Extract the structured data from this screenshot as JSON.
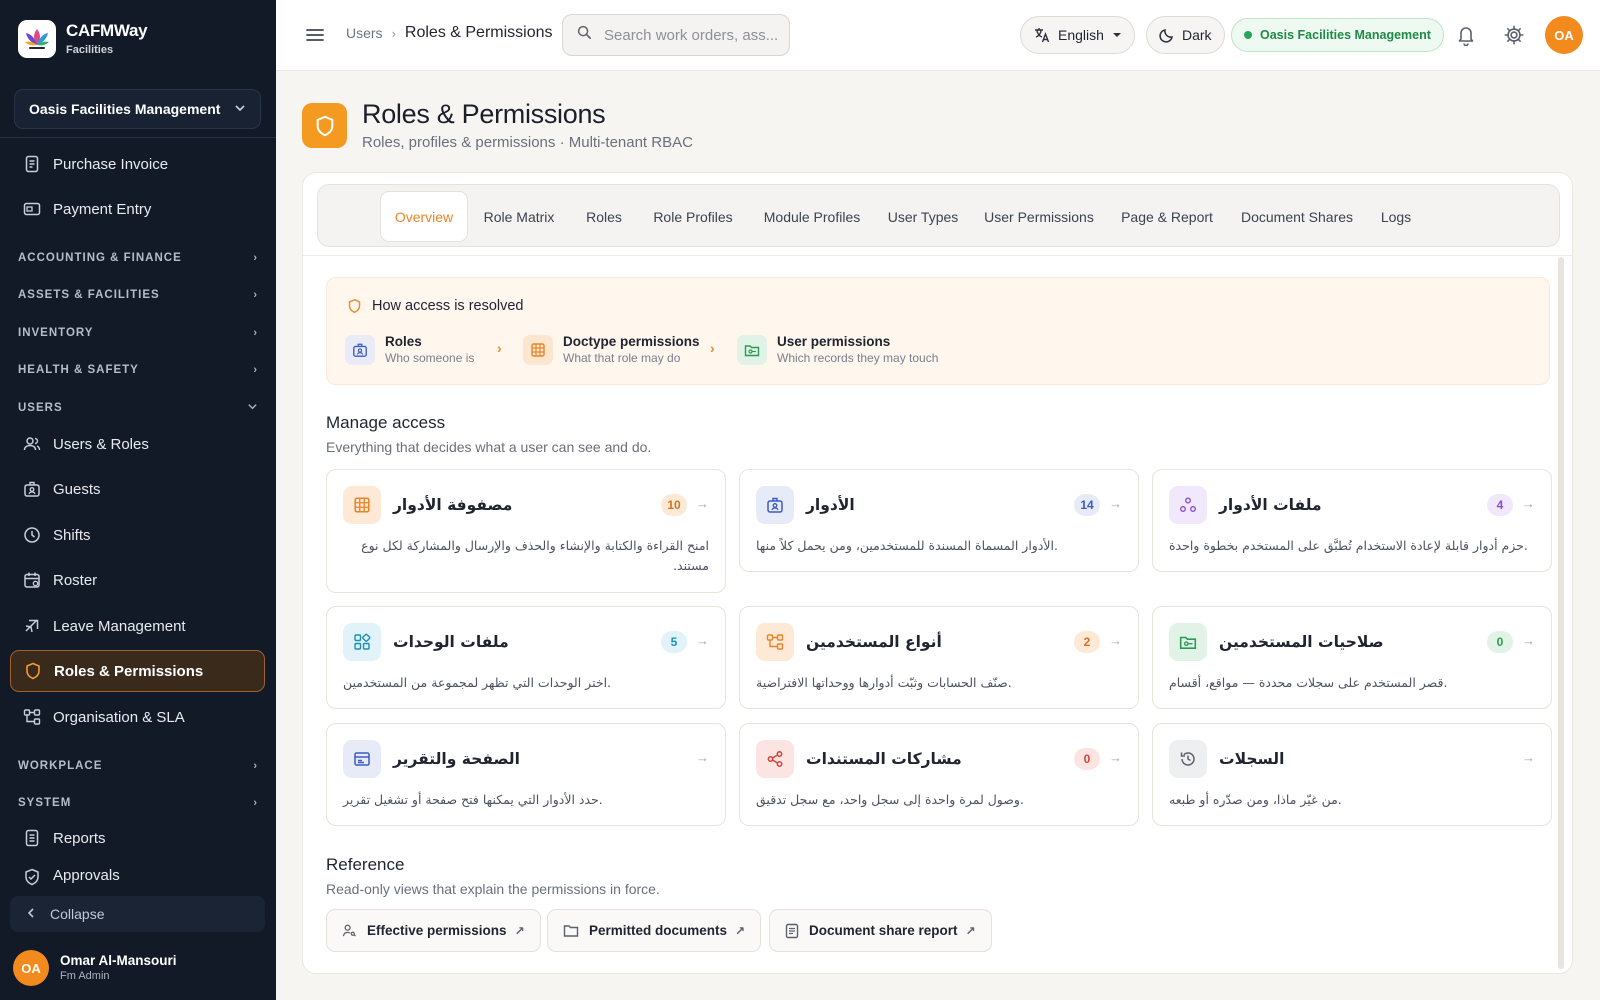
{
  "brand": {
    "name": "CAFMWay",
    "sub": "Facilities"
  },
  "sidebar": {
    "tenant": "Oasis Facilities Management",
    "items": [
      {
        "label": "Purchase Invoice"
      },
      {
        "label": "Payment Entry"
      },
      {
        "label": "Users & Roles"
      },
      {
        "label": "Guests"
      },
      {
        "label": "Shifts"
      },
      {
        "label": "Roster"
      },
      {
        "label": "Leave Management"
      },
      {
        "label": "Roles & Permissions"
      },
      {
        "label": "Organisation & SLA"
      },
      {
        "label": "Reports"
      },
      {
        "label": "Approvals"
      }
    ],
    "sections": [
      {
        "label": "ACCOUNTING & FINANCE"
      },
      {
        "label": "ASSETS & FACILITIES"
      },
      {
        "label": "INVENTORY"
      },
      {
        "label": "HEALTH & SAFETY"
      },
      {
        "label": "USERS"
      },
      {
        "label": "WORKPLACE"
      },
      {
        "label": "SYSTEM"
      }
    ],
    "collapse": "Collapse",
    "user": {
      "initials": "OA",
      "name": "Omar Al-Mansouri",
      "role": "Fm Admin"
    }
  },
  "topbar": {
    "breadcrumb": [
      "Users",
      "Roles & Permissions"
    ],
    "search_placeholder": "Search work orders, ass...",
    "language": "English",
    "theme": "Dark",
    "tenant": "Oasis Facilities Management",
    "avatar": "OA"
  },
  "page": {
    "title": "Roles & Permissions",
    "subtitle": "Roles, profiles & permissions · Multi-tenant RBAC"
  },
  "tabs": [
    {
      "label": "Overview",
      "active": true
    },
    {
      "label": "Role Matrix"
    },
    {
      "label": "Roles"
    },
    {
      "label": "Role Profiles"
    },
    {
      "label": "Module Profiles"
    },
    {
      "label": "User Types"
    },
    {
      "label": "User Permissions"
    },
    {
      "label": "Page & Report"
    },
    {
      "label": "Document Shares"
    },
    {
      "label": "Logs"
    }
  ],
  "resolution": {
    "title": "How access is resolved",
    "steps": [
      {
        "title": "Roles",
        "sub": "Who someone is"
      },
      {
        "title": "Doctype permissions",
        "sub": "What that role may do"
      },
      {
        "title": "User permissions",
        "sub": "Which records they may touch"
      }
    ]
  },
  "manage": {
    "title": "Manage access",
    "subtitle": "Everything that decides what a user can see and do.",
    "cards": [
      {
        "title": "مصفوفة الأدوار",
        "count": "10",
        "desc": "امنح القراءة والكتابة والإنشاء والحذف والإرسال والمشاركة لكل نوع مستند.",
        "icon": "grid-icon",
        "color": "#e8852a"
      },
      {
        "title": "الأدوار",
        "count": "14",
        "desc": ".الأدوار المسماة المسندة للمستخدمين، ومن يحمل كلاً منها",
        "icon": "badge-icon",
        "color": "#3b5cc4"
      },
      {
        "title": "ملفات الأدوار",
        "count": "4",
        "desc": ".حزم أدوار قابلة لإعادة الاستخدام تُطبَّق على المستخدم بخطوة واحدة",
        "icon": "nodes-icon",
        "color": "#8a4fd0"
      },
      {
        "title": "ملفات الوحدات",
        "count": "5",
        "desc": ".اختر الوحدات التي تظهر لمجموعة من المستخدمين",
        "icon": "modules-icon",
        "color": "#1d8fb0"
      },
      {
        "title": "أنواع المستخدمين",
        "count": "2",
        "desc": ".صنّف الحسابات وثبّت أدوارها ووحداتها الافتراضية",
        "icon": "hierarchy-icon",
        "color": "#e8852a"
      },
      {
        "title": "صلاحيات المستخدمين",
        "count": "0",
        "desc": ".قصر المستخدم على سجلات محددة — مواقع، أقسام",
        "icon": "folder-key-icon",
        "color": "#2b9a55"
      },
      {
        "title": "الصفحة والتقرير",
        "count": "",
        "desc": ".حدد الأدوار التي يمكنها فتح صفحة أو تشغيل تقرير",
        "icon": "window-icon",
        "color": "#3b5cc4"
      },
      {
        "title": "مشاركات المستندات",
        "count": "0",
        "desc": ".وصول لمرة واحدة إلى سجل واحد، مع سجل تدقيق",
        "icon": "share-icon",
        "color": "#d6443a"
      },
      {
        "title": "السجلات",
        "count": "",
        "desc": ".من غيّر ماذا، ومن صدّره أو طبعه",
        "icon": "history-icon",
        "color": "#5d636e"
      }
    ]
  },
  "reference": {
    "title": "Reference",
    "subtitle": "Read-only views that explain the permissions in force.",
    "buttons": [
      {
        "label": "Effective permissions"
      },
      {
        "label": "Permitted documents"
      },
      {
        "label": "Document share report"
      }
    ]
  },
  "colors": {
    "accent": "#f59a21",
    "sidebar_bg": "#121a28",
    "active_border": "#a0612b",
    "success": "#27a557"
  }
}
